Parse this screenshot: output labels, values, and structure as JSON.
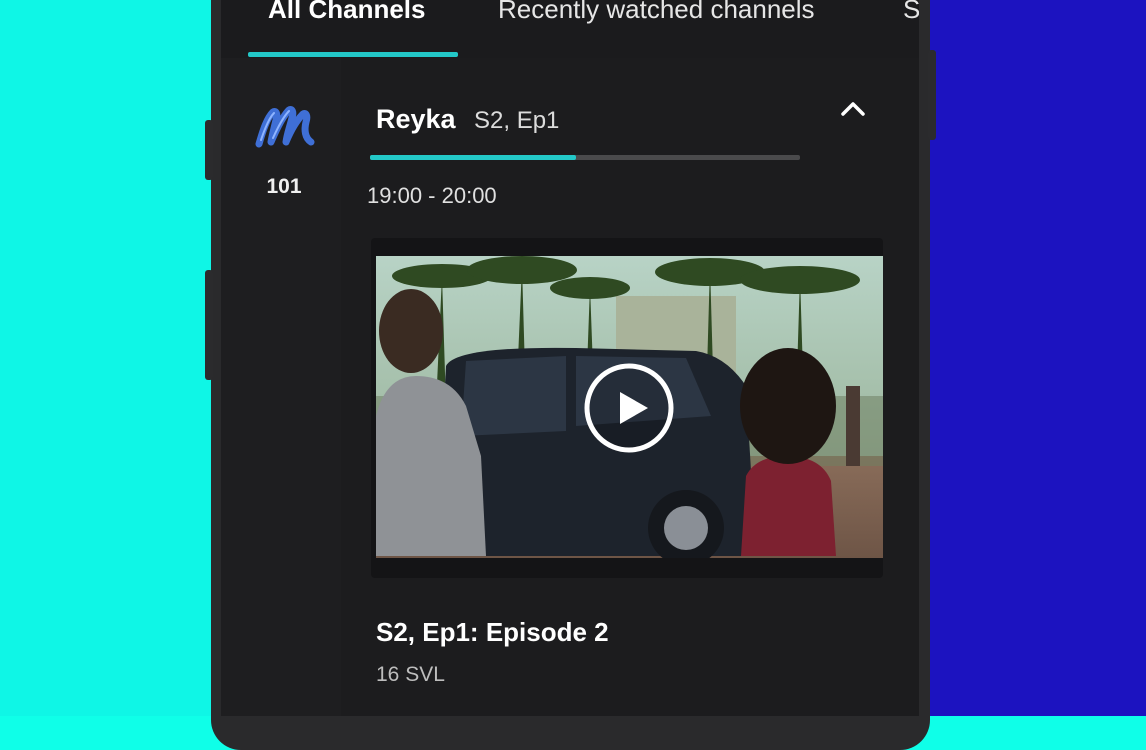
{
  "tabs": [
    {
      "label": "All Channels",
      "active": true
    },
    {
      "label": "Recently watched channels",
      "active": false
    },
    {
      "label": "S",
      "active": false
    }
  ],
  "channel": {
    "number": "101",
    "logo_icon": "mzansi-magic-logo-icon"
  },
  "program": {
    "title": "Reyka",
    "episode": "S2, Ep1",
    "time": "19:00 - 20:00",
    "progress": 0.48,
    "collapse_icon": "chevron-up-icon"
  },
  "episode": {
    "title": "S2, Ep1: Episode 2",
    "rating": "16 SVL",
    "play_icon": "play-icon"
  },
  "colors": {
    "accent": "#23c8c8",
    "left_bg": "#0ff6e6",
    "right_bg": "#1c13c0",
    "screen_bg": "#1c1c1e"
  }
}
